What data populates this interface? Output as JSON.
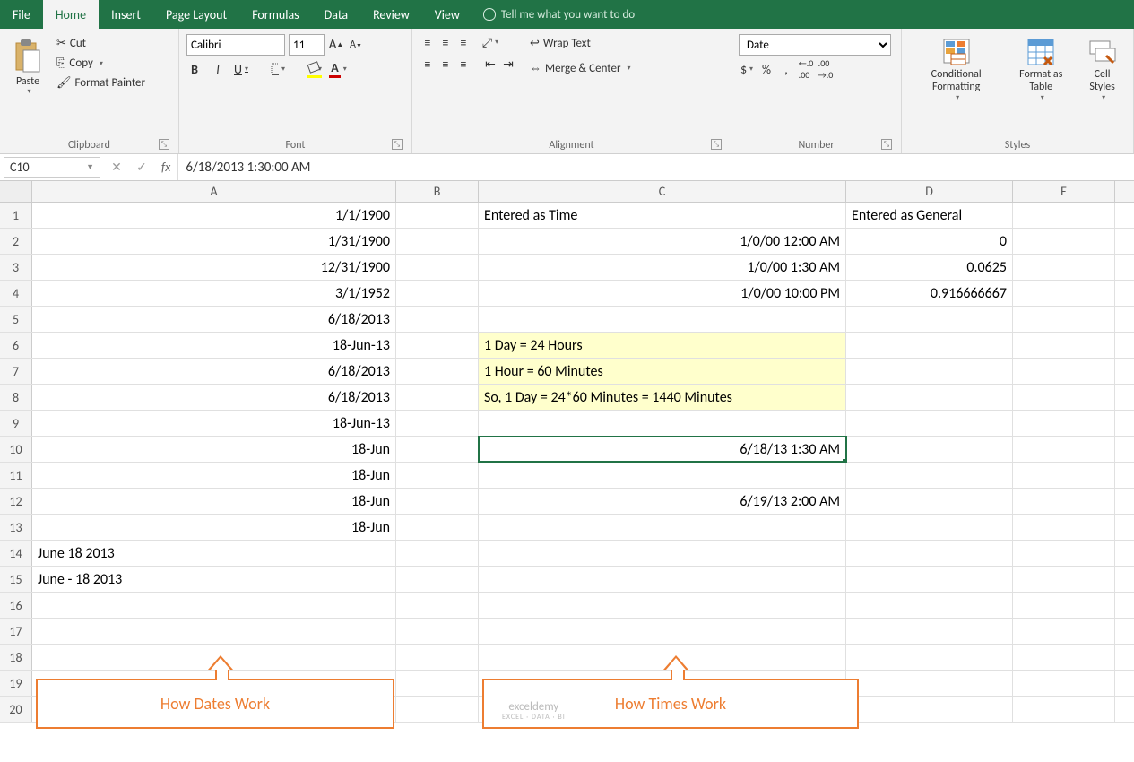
{
  "tabs": {
    "file": "File",
    "home": "Home",
    "insert": "Insert",
    "pageLayout": "Page Layout",
    "formulas": "Formulas",
    "data": "Data",
    "review": "Review",
    "view": "View",
    "tellme": "Tell me what you want to do"
  },
  "ribbon": {
    "clipboard": {
      "label": "Clipboard",
      "paste": "Paste",
      "cut": "Cut",
      "copy": "Copy",
      "painter": "Format Painter"
    },
    "font": {
      "label": "Font",
      "name": "Calibri",
      "size": "11",
      "bold": "B",
      "italic": "I",
      "underline": "U"
    },
    "alignment": {
      "label": "Alignment",
      "wrap": "Wrap Text",
      "merge": "Merge & Center"
    },
    "number": {
      "label": "Number",
      "format": "Date",
      "currency": "$",
      "percent": "%",
      "comma": ",",
      "incdec": "⁰⁰",
      "decdec": "⁰⁰"
    },
    "styles": {
      "label": "Styles",
      "cond": "Conditional Formatting",
      "table": "Format as Table",
      "cell": "Cell Styles"
    }
  },
  "namebox": "C10",
  "formula": "6/18/2013  1:30:00 AM",
  "cols": [
    "A",
    "B",
    "C",
    "D",
    "E"
  ],
  "rows": [
    "1",
    "2",
    "3",
    "4",
    "5",
    "6",
    "7",
    "8",
    "9",
    "10",
    "11",
    "12",
    "13",
    "14",
    "15",
    "16",
    "17",
    "18",
    "19",
    "20"
  ],
  "cells": {
    "A1": "1/1/1900",
    "A2": "1/31/1900",
    "A3": "12/31/1900",
    "A4": "3/1/1952",
    "A5": "6/18/2013",
    "A6": "18-Jun-13",
    "A7": "6/18/2013",
    "A8": "6/18/2013",
    "A9": "18-Jun-13",
    "A10": "18-Jun",
    "A11": "18-Jun",
    "A12": "18-Jun",
    "A13": "18-Jun",
    "A14": "June 18 2013",
    "A15": "June - 18 2013",
    "C1": "Entered as Time",
    "C2": "1/0/00 12:00 AM",
    "C3": "1/0/00 1:30 AM",
    "C4": "1/0/00 10:00 PM",
    "C6": "1 Day = 24 Hours",
    "C7": "1 Hour = 60 Minutes",
    "C8": "So, 1 Day = 24*60 Minutes = 1440 Minutes",
    "C10": "6/18/13 1:30 AM",
    "C12": "6/19/13 2:00 AM",
    "D1": "Entered as General",
    "D2": "0",
    "D3": "0.0625",
    "D4": "0.916666667"
  },
  "callouts": {
    "dates": "How Dates Work",
    "times": "How Times Work"
  },
  "watermark": {
    "main": "exceldemy",
    "sub": "EXCEL · DATA · BI"
  }
}
